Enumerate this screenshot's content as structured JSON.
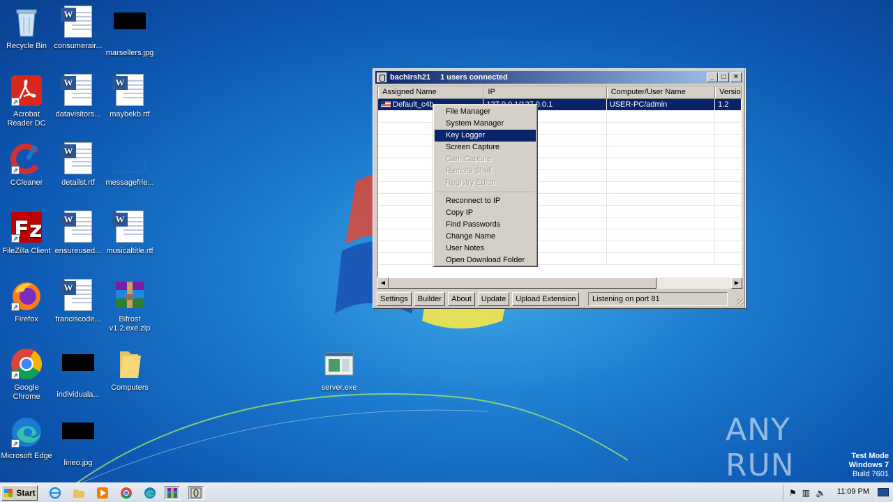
{
  "desktop": {
    "icons": [
      {
        "label": "Recycle Bin"
      },
      {
        "label": "consumerair..."
      },
      {
        "label": "marsellers.jpg"
      },
      {
        "label": "Acrobat Reader DC"
      },
      {
        "label": "datavisitors..."
      },
      {
        "label": "maybekb.rtf"
      },
      {
        "label": "CCleaner"
      },
      {
        "label": "detailst.rtf"
      },
      {
        "label": "messagefrie..."
      },
      {
        "label": "FileZilla Client"
      },
      {
        "label": "ensureused..."
      },
      {
        "label": "musicaltitle.rtf"
      },
      {
        "label": "Firefox"
      },
      {
        "label": "franciscode..."
      },
      {
        "label": "Bifrost v1.2.exe.zip"
      },
      {
        "label": "Google Chrome"
      },
      {
        "label": "individuala..."
      },
      {
        "label": "Computers"
      },
      {
        "label": "server.exe"
      },
      {
        "label": "Microsoft Edge"
      },
      {
        "label": "lineo.jpg"
      }
    ]
  },
  "window": {
    "title": "bachirsh21",
    "connected": "1 users connected",
    "columns": [
      "Assigned Name",
      "IP",
      "Computer/User Name",
      "Versio"
    ],
    "rows": [
      [
        "Default_c4b",
        "127.0.0.1/127.0.0.1",
        "USER-PC/admin",
        "1.2"
      ]
    ],
    "buttons": {
      "settings": "Settings",
      "builder": "Builder",
      "about": "About",
      "update": "Update",
      "upload": "Upload Extension"
    },
    "status": "Listening on port 81"
  },
  "context_menu": {
    "items": [
      {
        "label": "File Manager"
      },
      {
        "label": "System Manager"
      },
      {
        "label": "Key Logger"
      },
      {
        "label": "Screen Capture"
      },
      {
        "label": "Cam Capture"
      },
      {
        "label": "Remote Shell"
      },
      {
        "label": "Registry Editor"
      },
      {
        "label": "Reconnect to IP"
      },
      {
        "label": "Copy IP"
      },
      {
        "label": "Find Passwords"
      },
      {
        "label": "Change Name"
      },
      {
        "label": "User Notes"
      },
      {
        "label": "Open Download Folder"
      }
    ]
  },
  "watermark": {
    "brand": "ANY RUN",
    "mode": "Test Mode",
    "os": "Windows 7",
    "build": "Build 7601"
  },
  "taskbar": {
    "start": "Start",
    "clock": "11:09 PM"
  },
  "colors": {
    "selection": "#0a246a",
    "face": "#d4d0c8"
  }
}
